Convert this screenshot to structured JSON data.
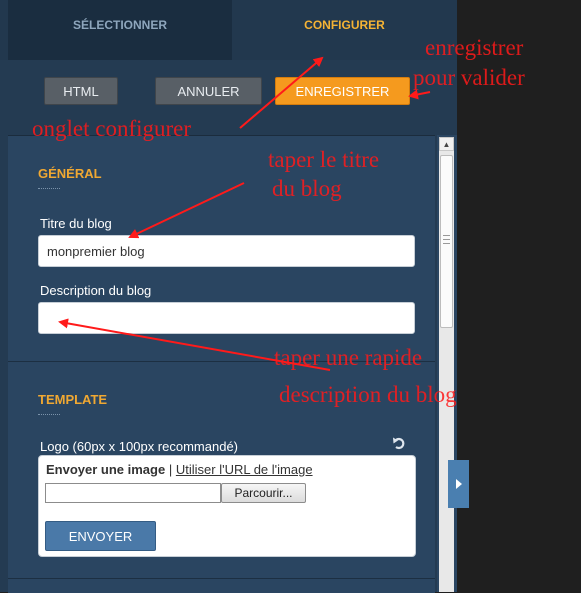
{
  "tabs": {
    "select": "SÉLECTIONNER",
    "configure": "CONFIGURER"
  },
  "toolbar": {
    "html": "HTML",
    "cancel": "ANNULER",
    "save": "ENREGISTRER"
  },
  "general": {
    "title": "GÉNÉRAL",
    "blog_title_label": "Titre du blog",
    "blog_title_value": "monpremier blog",
    "blog_desc_label": "Description du blog",
    "blog_desc_value": ""
  },
  "template": {
    "title": "TEMPLATE",
    "logo_label": "Logo (60px x 100px recommandé)",
    "upload_option": "Envoyer une image",
    "separator": "|",
    "url_option": "Utiliser l'URL de l'image",
    "browse": "Parcourir...",
    "send": "ENVOYER"
  },
  "annotations": {
    "save_line1": "enregistrer",
    "save_line2": "pour valider",
    "configure_tab": "onglet configurer",
    "title_line1": "taper le titre",
    "title_line2": "du blog",
    "desc_line1": "taper une rapide",
    "desc_line2": "description  du blog"
  },
  "icons": {
    "revert": "undo-icon",
    "expand": "chevron-right-icon",
    "scroll_up": "scroll-up-arrow-icon"
  },
  "colors": {
    "panel": "#243b52",
    "accent": "#f5b335",
    "save_button": "#f59a1e",
    "annotation": "#ff1a1a"
  }
}
